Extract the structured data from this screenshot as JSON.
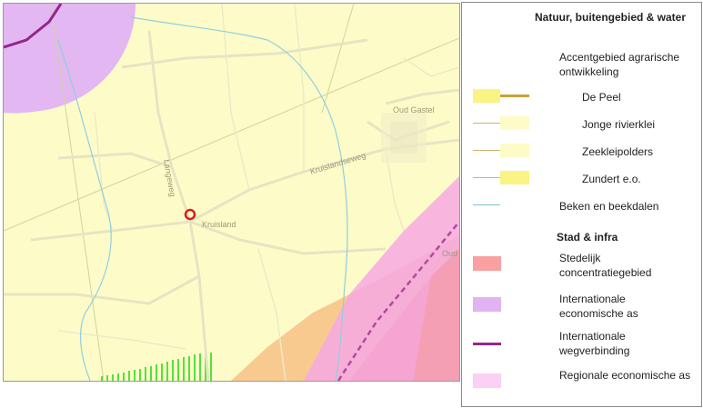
{
  "map": {
    "place_labels": {
      "oud_gastel": "Oud Gastel",
      "kruisland": "Kruisland",
      "langeweg": "Langeweg",
      "kruislandseweg": "Kruislandseweg",
      "oud": "Oud"
    },
    "marker": "location-marker"
  },
  "legend": {
    "sections": [
      {
        "title": "Natuur, buitengebied & water",
        "items": [
          {
            "label": "Accentgebied agrarische ontwikkeling",
            "swatch": "none"
          },
          {
            "label": "De Peel",
            "swatch": "fill-line",
            "fill": "#f9f483",
            "line": "#c9a133"
          },
          {
            "label": "Jonge rivierklei",
            "swatch": "line-fill",
            "fill": "#fdfbc8",
            "line": "#c9b46a"
          },
          {
            "label": "Zeekleipolders",
            "swatch": "line-fill",
            "fill": "#fdfbc8",
            "line": "#c9b46a"
          },
          {
            "label": "Zundert e.o.",
            "swatch": "line-fill",
            "fill": "#f9f483",
            "line": "#c9b46a"
          },
          {
            "label": "Beken en beekdalen",
            "swatch": "line",
            "line": "#7ec3d3"
          }
        ]
      },
      {
        "title": "Stad & infra",
        "items": [
          {
            "label": "Stedelijk concentratiegebied",
            "swatch": "fill",
            "fill": "#f9a0a0"
          },
          {
            "label": "Internationale economische as",
            "swatch": "fill",
            "fill": "#e2b3f3"
          },
          {
            "label": "Internationale wegverbinding",
            "swatch": "line",
            "line": "#92278f"
          },
          {
            "label": "Regionale economische as",
            "swatch": "fill",
            "fill": "#fbd0f4"
          }
        ]
      }
    ]
  }
}
